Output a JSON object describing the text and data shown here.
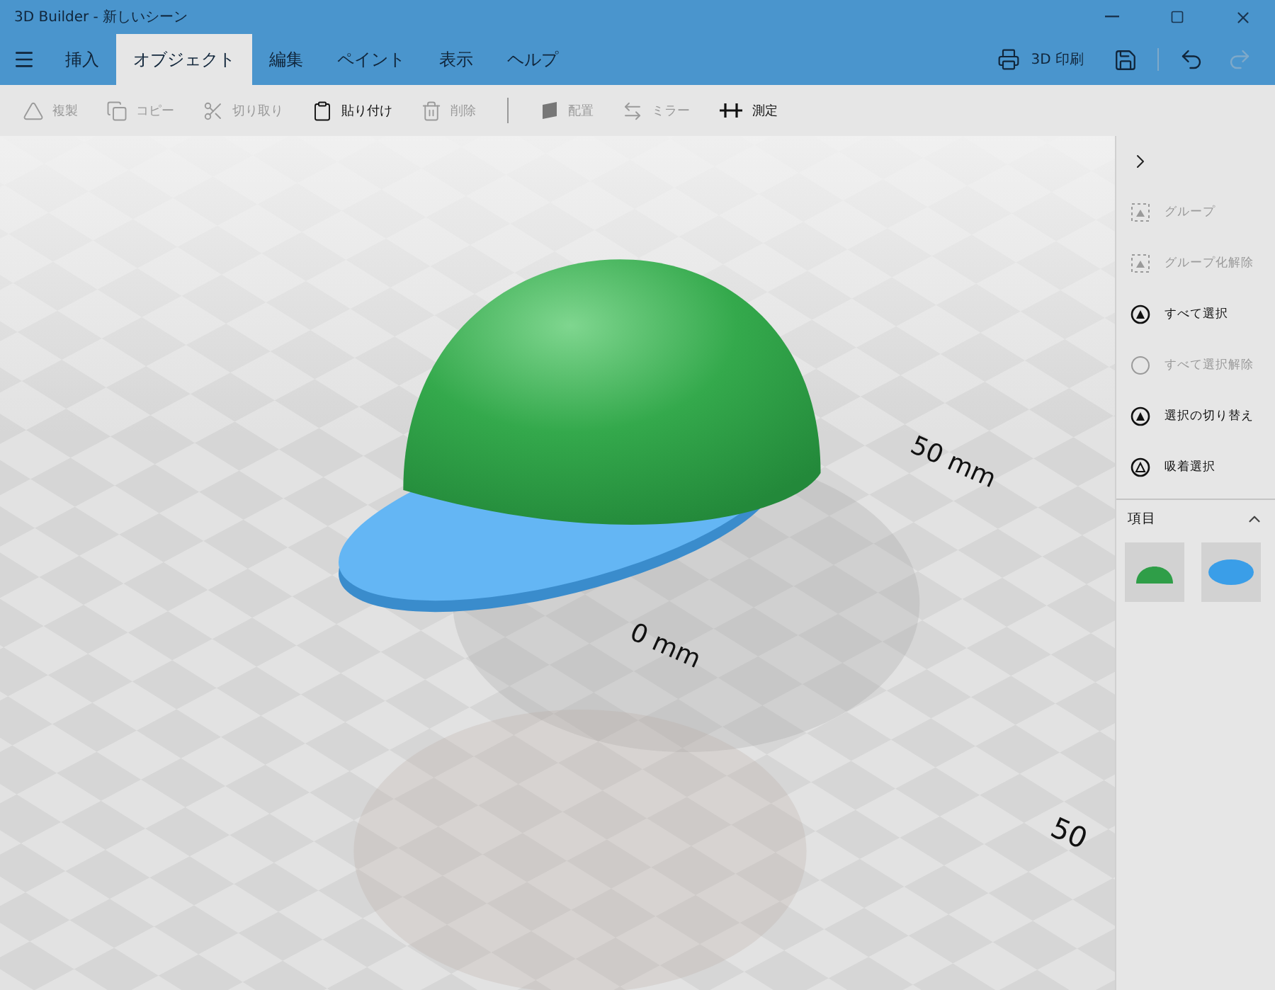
{
  "window": {
    "title": "3D Builder - 新しいシーン"
  },
  "menu_tabs": [
    {
      "label": "挿入",
      "selected": false
    },
    {
      "label": "オブジェクト",
      "selected": true
    },
    {
      "label": "編集",
      "selected": false
    },
    {
      "label": "ペイント",
      "selected": false
    },
    {
      "label": "表示",
      "selected": false
    },
    {
      "label": "ヘルプ",
      "selected": false
    }
  ],
  "print_button": {
    "label": "3D 印刷"
  },
  "quick_buttons": [
    {
      "kind": "save",
      "disabled": false
    },
    {
      "kind": "undo",
      "disabled": false
    },
    {
      "kind": "redo",
      "disabled": true
    }
  ],
  "toolbar": [
    {
      "kind": "duplicate",
      "label": "複製",
      "disabled": true
    },
    {
      "kind": "copy",
      "label": "コピー",
      "disabled": true
    },
    {
      "kind": "cut",
      "label": "切り取り",
      "disabled": true
    },
    {
      "kind": "paste",
      "label": "貼り付け",
      "disabled": false
    },
    {
      "kind": "delete",
      "label": "削除",
      "disabled": true
    },
    {
      "kind": "separator"
    },
    {
      "kind": "place",
      "label": "配置",
      "disabled": true
    },
    {
      "kind": "mirror",
      "label": "ミラー",
      "disabled": true
    },
    {
      "kind": "measure",
      "label": "測定",
      "disabled": false
    }
  ],
  "viewport": {
    "labels": [
      "50 mm",
      "0 mm",
      "50"
    ]
  },
  "side_panel": {
    "actions": [
      {
        "kind": "group",
        "label": "グループ",
        "disabled": true
      },
      {
        "kind": "group",
        "label": "グループ化解除",
        "disabled": true
      },
      {
        "kind": "select",
        "label": "すべて選択",
        "disabled": false
      },
      {
        "kind": "ring",
        "label": "すべて選択解除",
        "disabled": true
      },
      {
        "kind": "select",
        "label": "選択の切り替え",
        "disabled": false
      },
      {
        "kind": "snap",
        "label": "吸着選択",
        "disabled": false
      }
    ],
    "section": {
      "title": "項目",
      "expanded": true
    },
    "items": [
      {
        "kind": "dome"
      },
      {
        "kind": "disc"
      }
    ]
  }
}
